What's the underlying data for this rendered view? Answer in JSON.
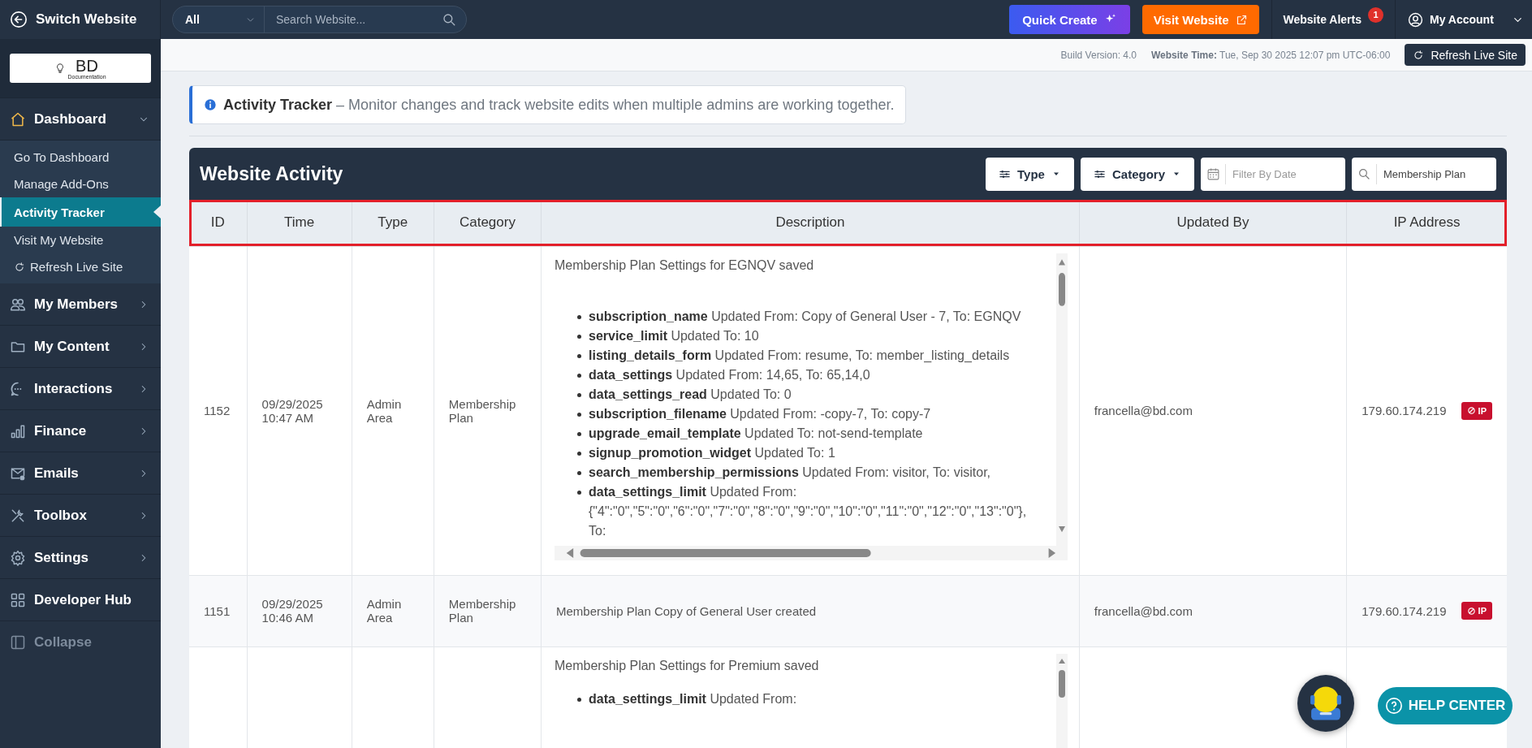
{
  "topbar": {
    "switch_label": "Switch Website",
    "search_scope": "All",
    "search_placeholder": "Search Website...",
    "quick_create": "Quick Create",
    "visit_website": "Visit Website",
    "alerts_label": "Website Alerts",
    "alerts_count": "1",
    "account_label": "My Account"
  },
  "logo": {
    "mark": "BD",
    "caption": "Documentation"
  },
  "sidebar": {
    "items": [
      {
        "label": "Dashboard",
        "expanded": true,
        "children": [
          {
            "label": "Go To Dashboard",
            "kind": "link",
            "selected": false
          },
          {
            "label": "Manage Add-Ons",
            "kind": "link",
            "selected": false
          },
          {
            "label": "Activity Tracker",
            "kind": "link",
            "selected": true
          },
          {
            "label": "Visit My Website",
            "kind": "link",
            "selected": false
          },
          {
            "label": "Refresh Live Site",
            "kind": "refresh",
            "selected": false
          }
        ]
      },
      {
        "label": "My Members",
        "expanded": false
      },
      {
        "label": "My Content",
        "expanded": false
      },
      {
        "label": "Interactions",
        "expanded": false
      },
      {
        "label": "Finance",
        "expanded": false
      },
      {
        "label": "Emails",
        "expanded": false
      },
      {
        "label": "Toolbox",
        "expanded": false
      },
      {
        "label": "Settings",
        "expanded": false
      },
      {
        "label": "Developer Hub"
      }
    ],
    "collapse_label": "Collapse"
  },
  "status_bar": {
    "build": "Build Version: 4.0",
    "time": "**Website Time:** Tue, Sep 30 2025 12:07 pm UTC-06:00",
    "refresh_label": "Refresh Live Site"
  },
  "notice": "**Activity Tracker** – Monitor changes and track website edits when multiple admins are working together.",
  "activity": {
    "title": "Website Activity",
    "filters": [
      {
        "kind": "dropdown",
        "label": "Type"
      },
      {
        "kind": "dropdown",
        "label": "Category"
      },
      {
        "kind": "date",
        "placeholder": "Filter By Date"
      },
      {
        "kind": "search",
        "value": "Membership Plan"
      }
    ],
    "header_highlighted": true,
    "columns": [
      "ID",
      "Time",
      "Type",
      "Category",
      "Description",
      "Updated By",
      "IP Address"
    ],
    "rows": [
      {
        "id": "1152",
        "date": "09/29/2025",
        "time": "10:47 AM",
        "type": "Admin Area",
        "category": "Membership Plan",
        "description": {
          "summary": "Membership Plan Settings for EGNQV saved",
          "changes": [
            {
              "field": "subscription_name",
              "text": "Updated From: Copy of General User - 7, To: EGNQV"
            },
            {
              "field": "service_limit",
              "text": "Updated To: 10"
            },
            {
              "field": "listing_details_form",
              "text": "Updated From: resume, To: member_listing_details"
            },
            {
              "field": "data_settings",
              "text": "Updated From: 14,65, To: 65,14,0"
            },
            {
              "field": "data_settings_read",
              "text": "Updated To: 0"
            },
            {
              "field": "subscription_filename",
              "text": "Updated From: -copy-7, To: copy-7"
            },
            {
              "field": "upgrade_email_template",
              "text": "Updated To: not-send-template"
            },
            {
              "field": "signup_promotion_widget",
              "text": "Updated To: 1"
            },
            {
              "field": "search_membership_permissions",
              "text": "Updated From: visitor, To: visitor,"
            },
            {
              "field": "data_settings_limit",
              "text": "Updated From:\n{\"4\":\"0\",\"5\":\"0\",\"6\":\"0\",\"7\":\"0\",\"8\":\"0\",\"9\":\"0\",\"10\":\"0\",\"11\":\"0\",\"12\":\"0\",\"13\":\"0\"},\nTo:"
            }
          ]
        },
        "updated_by": "francella@bd.com",
        "ip": "179.60.174.219",
        "ban_label": "IP"
      },
      {
        "id": "1151",
        "date": "09/29/2025",
        "time": "10:46 AM",
        "type": "Admin Area",
        "category": "Membership Plan",
        "description": {
          "summary": "Membership Plan Copy of General User created"
        },
        "updated_by": "francella@bd.com",
        "ip": "179.60.174.219",
        "ban_label": "IP"
      },
      {
        "description": {
          "summary": "Membership Plan Settings for Premium saved",
          "changes": [
            {
              "field": "data_settings_limit",
              "text": "Updated From:"
            }
          ]
        }
      }
    ]
  },
  "help": {
    "label": "HELP CENTER"
  }
}
